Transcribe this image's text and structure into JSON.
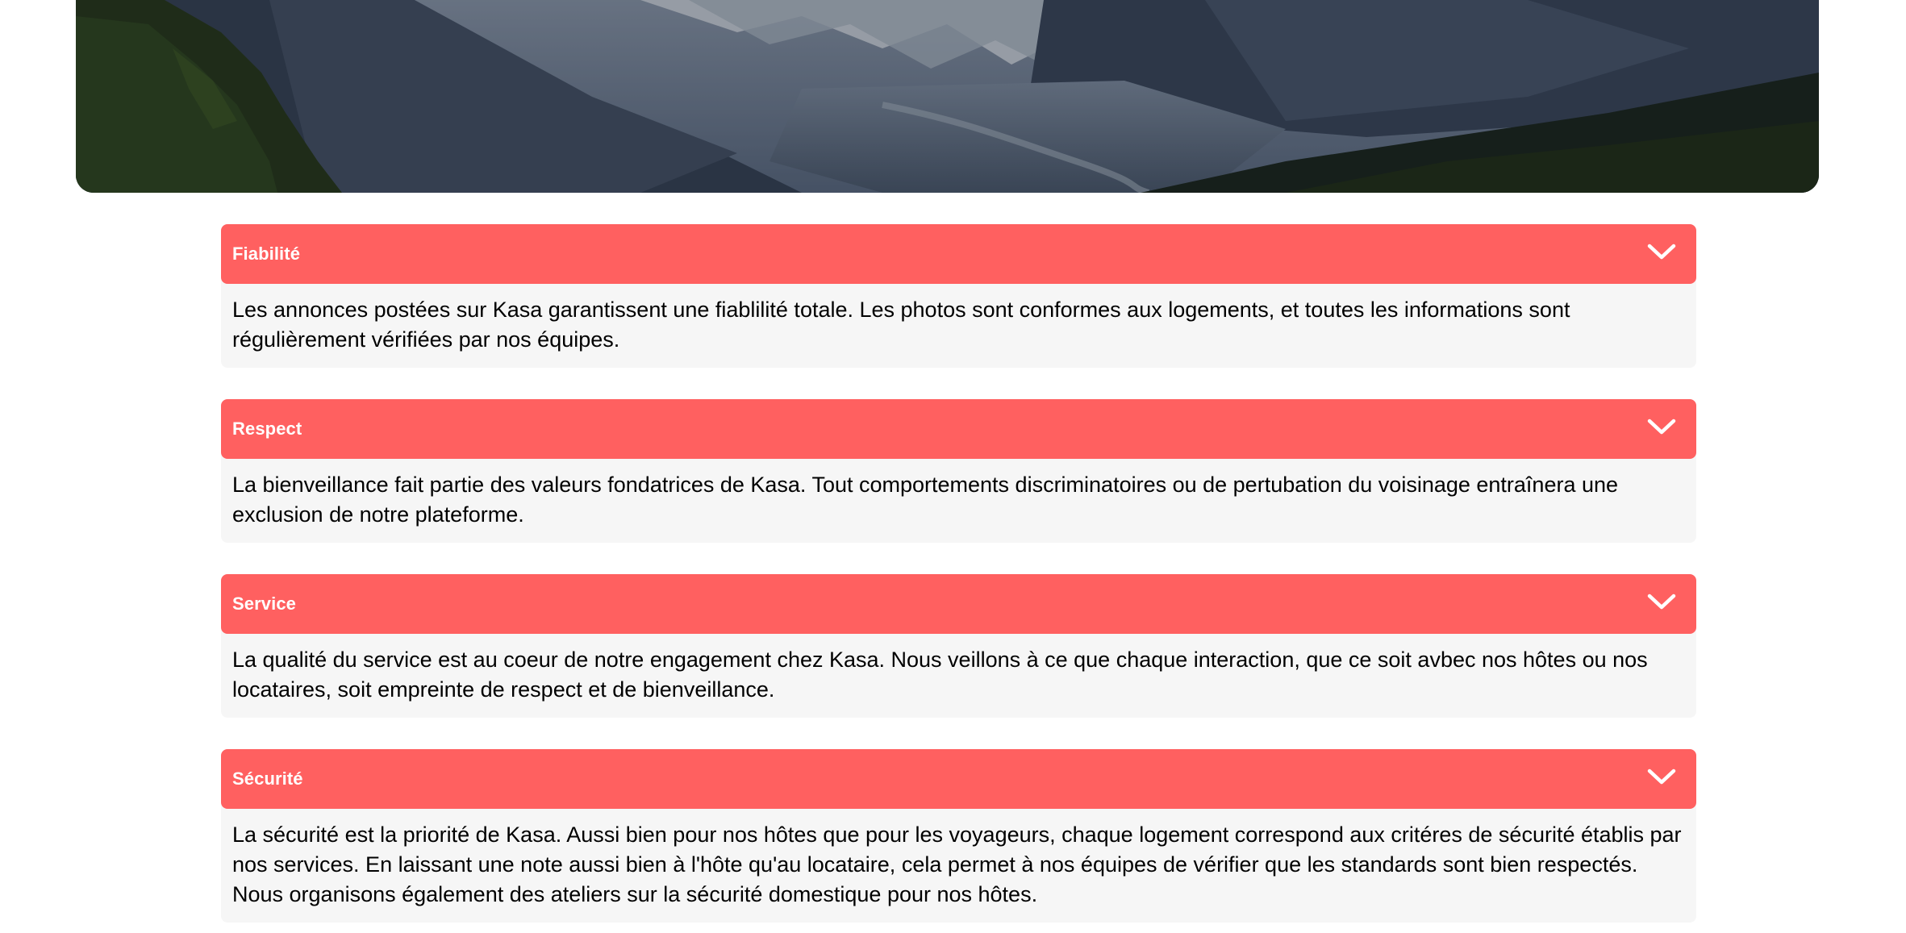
{
  "banner": {
    "image": "mountain-landscape-banner"
  },
  "colors": {
    "accent": "#FF6060",
    "panel_background": "#F6F6F6",
    "header_text": "#FFFFFF"
  },
  "collapses": [
    {
      "title": "Fiabilité",
      "icon": "chevron-down-icon",
      "text": "Les annonces postées sur Kasa garantissent une fiablilité totale. Les photos sont conformes aux logements, et toutes les informations sont régulièrement vérifiées par nos équipes."
    },
    {
      "title": "Respect",
      "icon": "chevron-down-icon",
      "text": "La bienveillance fait partie des valeurs fondatrices de Kasa. Tout comportements discriminatoires ou de pertubation du voisinage entraînera une exclusion de notre plateforme."
    },
    {
      "title": "Service",
      "icon": "chevron-down-icon",
      "text": "La qualité du service est au coeur de notre engagement chez Kasa. Nous veillons à ce que chaque interaction, que ce soit avbec nos hôtes ou nos locataires, soit empreinte de respect et de bienveillance."
    },
    {
      "title": "Sécurité",
      "icon": "chevron-down-icon",
      "text": "La sécurité est la priorité de Kasa. Aussi bien pour nos hôtes que pour les voyageurs, chaque logement correspond aux critéres de sécurité établis par nos services. En laissant une note aussi bien à l'hôte qu'au locataire, cela permet à nos équipes de vérifier que les standards sont bien respectés. Nous organisons également des ateliers sur la sécurité domestique pour nos hôtes."
    }
  ]
}
